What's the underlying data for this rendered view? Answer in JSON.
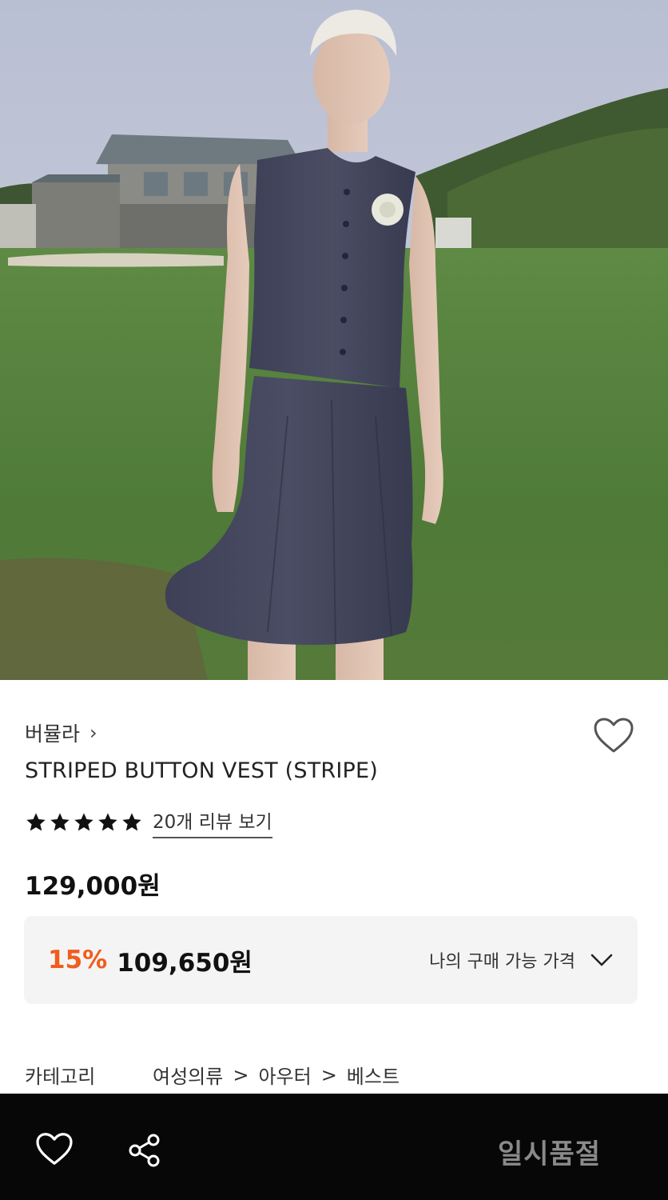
{
  "product": {
    "brand": "버뮬라",
    "brand_chevron": "›",
    "title": "STRIPED BUTTON VEST (STRIPE)",
    "rating_stars": 5,
    "review_link": "20개 리뷰 보기",
    "original_price": "129,000원"
  },
  "price_box": {
    "discount_rate": "15%",
    "discount_price": "109,650원",
    "my_price_label": "나의 구매 가능 가격"
  },
  "category": {
    "label": "카테고리",
    "path": [
      "여성의류",
      "아우터",
      "베스트"
    ],
    "separator": ">"
  },
  "bottom_bar": {
    "status": "일시품절"
  },
  "icons": {
    "wishlist": "heart-outline-icon",
    "share": "share-icon",
    "star": "star-icon",
    "chevron": "chevron-down-icon"
  },
  "colors": {
    "discount": "#f25c1c",
    "bottom_bar": "#070707",
    "soldout_text": "#8a8a8a",
    "price_box_bg": "#f4f4f4"
  }
}
